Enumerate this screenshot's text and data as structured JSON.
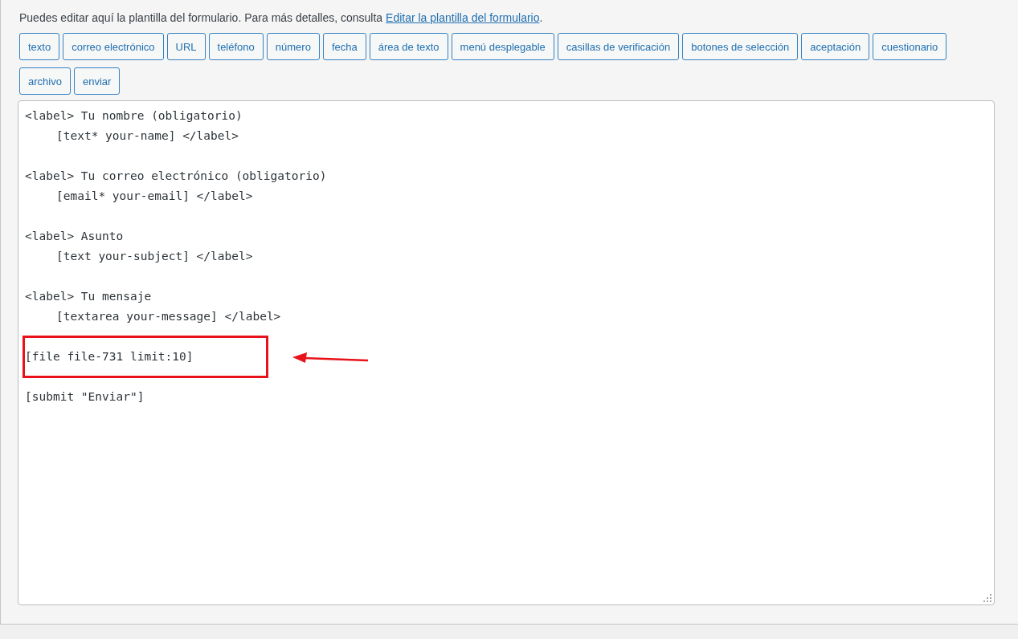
{
  "intro": {
    "text": "Puedes editar aquí la plantilla del formulario. Para más detalles, consulta",
    "link": "Editar la plantilla del formulario",
    "suffix": "."
  },
  "tag_buttons": [
    "texto",
    "correo electrónico",
    "URL",
    "teléfono",
    "número",
    "fecha",
    "área de texto",
    "menú desplegable",
    "casillas de verificación",
    "botones de selección",
    "aceptación",
    "cuestionario",
    "archivo",
    "enviar"
  ],
  "editor": {
    "blocks": [
      {
        "highlighted": false,
        "lines": [
          {
            "kind": "plain",
            "text": "<label> Tu nombre (obligatorio)"
          },
          {
            "kind": "indented",
            "text": "[text* your-name] </label>"
          }
        ]
      },
      {
        "highlighted": false,
        "lines": [
          {
            "kind": "plain",
            "text": "<label> Tu correo electrónico (obligatorio)"
          },
          {
            "kind": "indented",
            "text": "[email* your-email] </label>"
          }
        ]
      },
      {
        "highlighted": false,
        "lines": [
          {
            "kind": "plain",
            "text": "<label> Asunto"
          },
          {
            "kind": "indented",
            "text": "[text your-subject] </label>"
          }
        ]
      },
      {
        "highlighted": false,
        "lines": [
          {
            "kind": "plain",
            "text": "<label> Tu mensaje"
          },
          {
            "kind": "indented",
            "text": "[textarea your-message] </label>"
          }
        ]
      },
      {
        "highlighted": true,
        "lines": [
          {
            "kind": "plain",
            "text": "[file file-731 limit:10]"
          }
        ]
      },
      {
        "highlighted": false,
        "lines": [
          {
            "kind": "plain",
            "text": "[submit \"Enviar\"]"
          }
        ]
      }
    ]
  }
}
